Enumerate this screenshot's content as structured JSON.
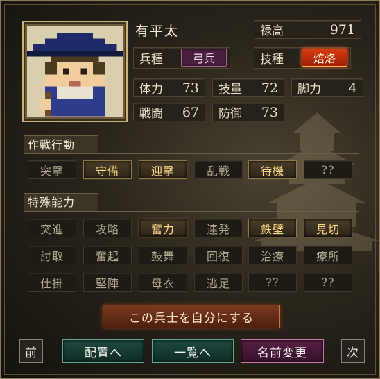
{
  "character": {
    "name": "有平太",
    "stipend_label": "禄高",
    "stipend_value": "971",
    "unit_type_label": "兵種",
    "unit_type_value": "弓兵",
    "skill_label": "技種",
    "skill_value": "焙烙"
  },
  "stats": [
    {
      "label": "体力",
      "value": "73"
    },
    {
      "label": "技量",
      "value": "72"
    },
    {
      "label": "脚力",
      "value": "4"
    },
    {
      "label": "戦闘",
      "value": "67"
    },
    {
      "label": "防御",
      "value": "73"
    }
  ],
  "tactics": {
    "title": "作戦行動",
    "buttons": [
      "突撃",
      "守備",
      "迎撃",
      "乱戦",
      "待機",
      "??"
    ]
  },
  "abilities": {
    "title": "特殊能力",
    "row1": [
      "突進",
      "攻略",
      "奮力",
      "連発",
      "鉄壁",
      "見切"
    ],
    "row2": [
      "討取",
      "奮起",
      "鼓舞",
      "回復",
      "治療",
      "療所"
    ],
    "row3": [
      "仕掛",
      "堅陣",
      "母衣",
      "逃足",
      "??",
      "??"
    ]
  },
  "actions": {
    "make_own": "この兵士を自分にする",
    "prev": "前",
    "next": "次",
    "deploy": "配置へ",
    "list": "一覧へ",
    "rename": "名前変更"
  },
  "colors": {
    "accent_red": "#d83a10",
    "accent_purple": "#4a2040",
    "accent_green": "#1e4b42",
    "accent_pink": "#5a1f45"
  }
}
